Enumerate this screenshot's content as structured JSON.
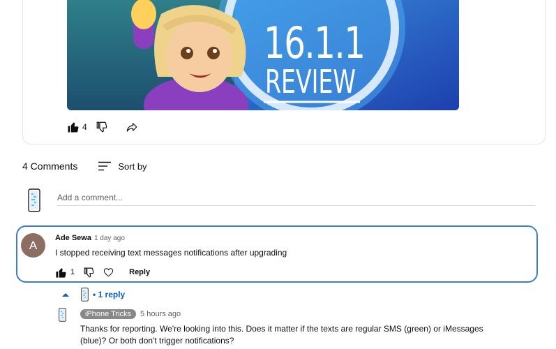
{
  "video": {
    "overlay_version": "16.1.1",
    "overlay_word": "REVIEW",
    "like_count": "4"
  },
  "comments_section": {
    "count_label": "4 Comments",
    "sort_label": "Sort by",
    "add_placeholder": "Add a comment..."
  },
  "comment": {
    "avatar_letter": "A",
    "author": "Ade Sewa",
    "time": "1 day ago",
    "text": "I stopped receiving text messages notifications after upgrading",
    "like_count": "1",
    "reply_label": "Reply"
  },
  "replies_toggle": {
    "label": "• 1 reply"
  },
  "reply": {
    "author": "iPhone Tricks",
    "time": "5 hours ago",
    "text": "Thanks for reporting. We're looking into this. Does it matter if the texts are regular SMS (green) or iMessages (blue)? Or both don't trigger notifications?"
  },
  "colors": {
    "highlight_border": "#3c7bd6",
    "link_blue": "#065fd4",
    "avatar_bg": "#8d6e63"
  }
}
